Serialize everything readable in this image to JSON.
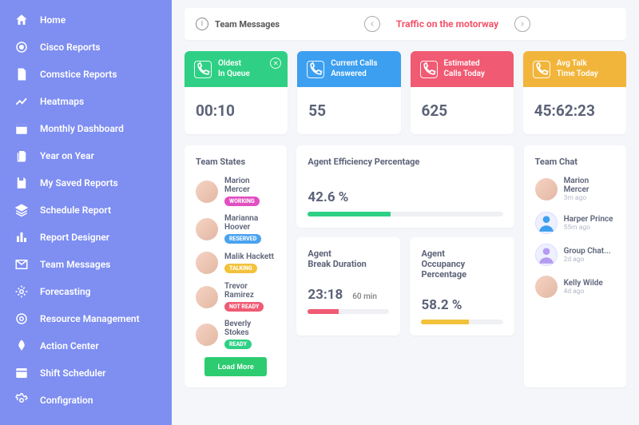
{
  "sidebar": {
    "items": [
      {
        "label": "Home"
      },
      {
        "label": "Cisco Reports"
      },
      {
        "label": "Comstice Reports"
      },
      {
        "label": "Heatmaps"
      },
      {
        "label": "Monthly Dashboard"
      },
      {
        "label": "Year on Year"
      },
      {
        "label": "My Saved Reports"
      },
      {
        "label": "Schedule Report"
      },
      {
        "label": "Report Designer"
      },
      {
        "label": "Team Messages"
      },
      {
        "label": "Forecasting"
      },
      {
        "label": "Resource Management"
      },
      {
        "label": "Action Center"
      },
      {
        "label": "Shift Scheduler"
      },
      {
        "label": "Configration"
      }
    ]
  },
  "messages_bar": {
    "label": "Team Messages",
    "headline": "Traffic on the motorway"
  },
  "cards": [
    {
      "title": "Oldest\nIn Queue",
      "value": "00:10",
      "color": "#2fd085",
      "closable": true
    },
    {
      "title": "Current Calls\nAnswered",
      "value": "55",
      "color": "#3c9ff0"
    },
    {
      "title": "Estimated\nCalls Today",
      "value": "625",
      "color": "#f05a73"
    },
    {
      "title": "Avg Talk\nTime Today",
      "value": "45:62:23",
      "color": "#f2b53b"
    }
  ],
  "team_states": {
    "title": "Team States",
    "people": [
      {
        "name": "Marion Mercer",
        "status": "WORKING",
        "badge_color": "#e24fc1"
      },
      {
        "name": "Marianna Hoover",
        "status": "RESERVED",
        "badge_color": "#4aa3f0"
      },
      {
        "name": "Malik Hackett",
        "status": "TALKING",
        "badge_color": "#f2c23b"
      },
      {
        "name": "Trevor Ramirez",
        "status": "NOT READY",
        "badge_color": "#f05a73"
      },
      {
        "name": "Beverly Stokes",
        "status": "READY",
        "badge_color": "#2fd085"
      }
    ],
    "load_more": "Load More"
  },
  "efficiency": {
    "title": "Agent Efficiency Percentage",
    "value": "42.6 %",
    "pct": 42.6,
    "color": "#2fd085"
  },
  "break": {
    "title": "Agent\nBreak Duration",
    "value": "23:18",
    "max_label": "60 min",
    "pct": 38,
    "color": "#f05a73"
  },
  "occupancy": {
    "title": "Agent\nOccupancy Percentage",
    "value": "58.2 %",
    "pct": 58.2,
    "color": "#f2c23b"
  },
  "team_chat": {
    "title": "Team Chat",
    "items": [
      {
        "name": "Marion Mercer",
        "time": "3m ago",
        "avatar": false
      },
      {
        "name": "Harper Prince",
        "time": "55m ago",
        "avatar": true,
        "av_color": "#3c9ff0"
      },
      {
        "name": "Group Chat...",
        "time": "2d ago",
        "avatar": true,
        "av_color": "#b49bf2"
      },
      {
        "name": "Kelly Wilde",
        "time": "4d ago",
        "avatar": false
      }
    ]
  }
}
